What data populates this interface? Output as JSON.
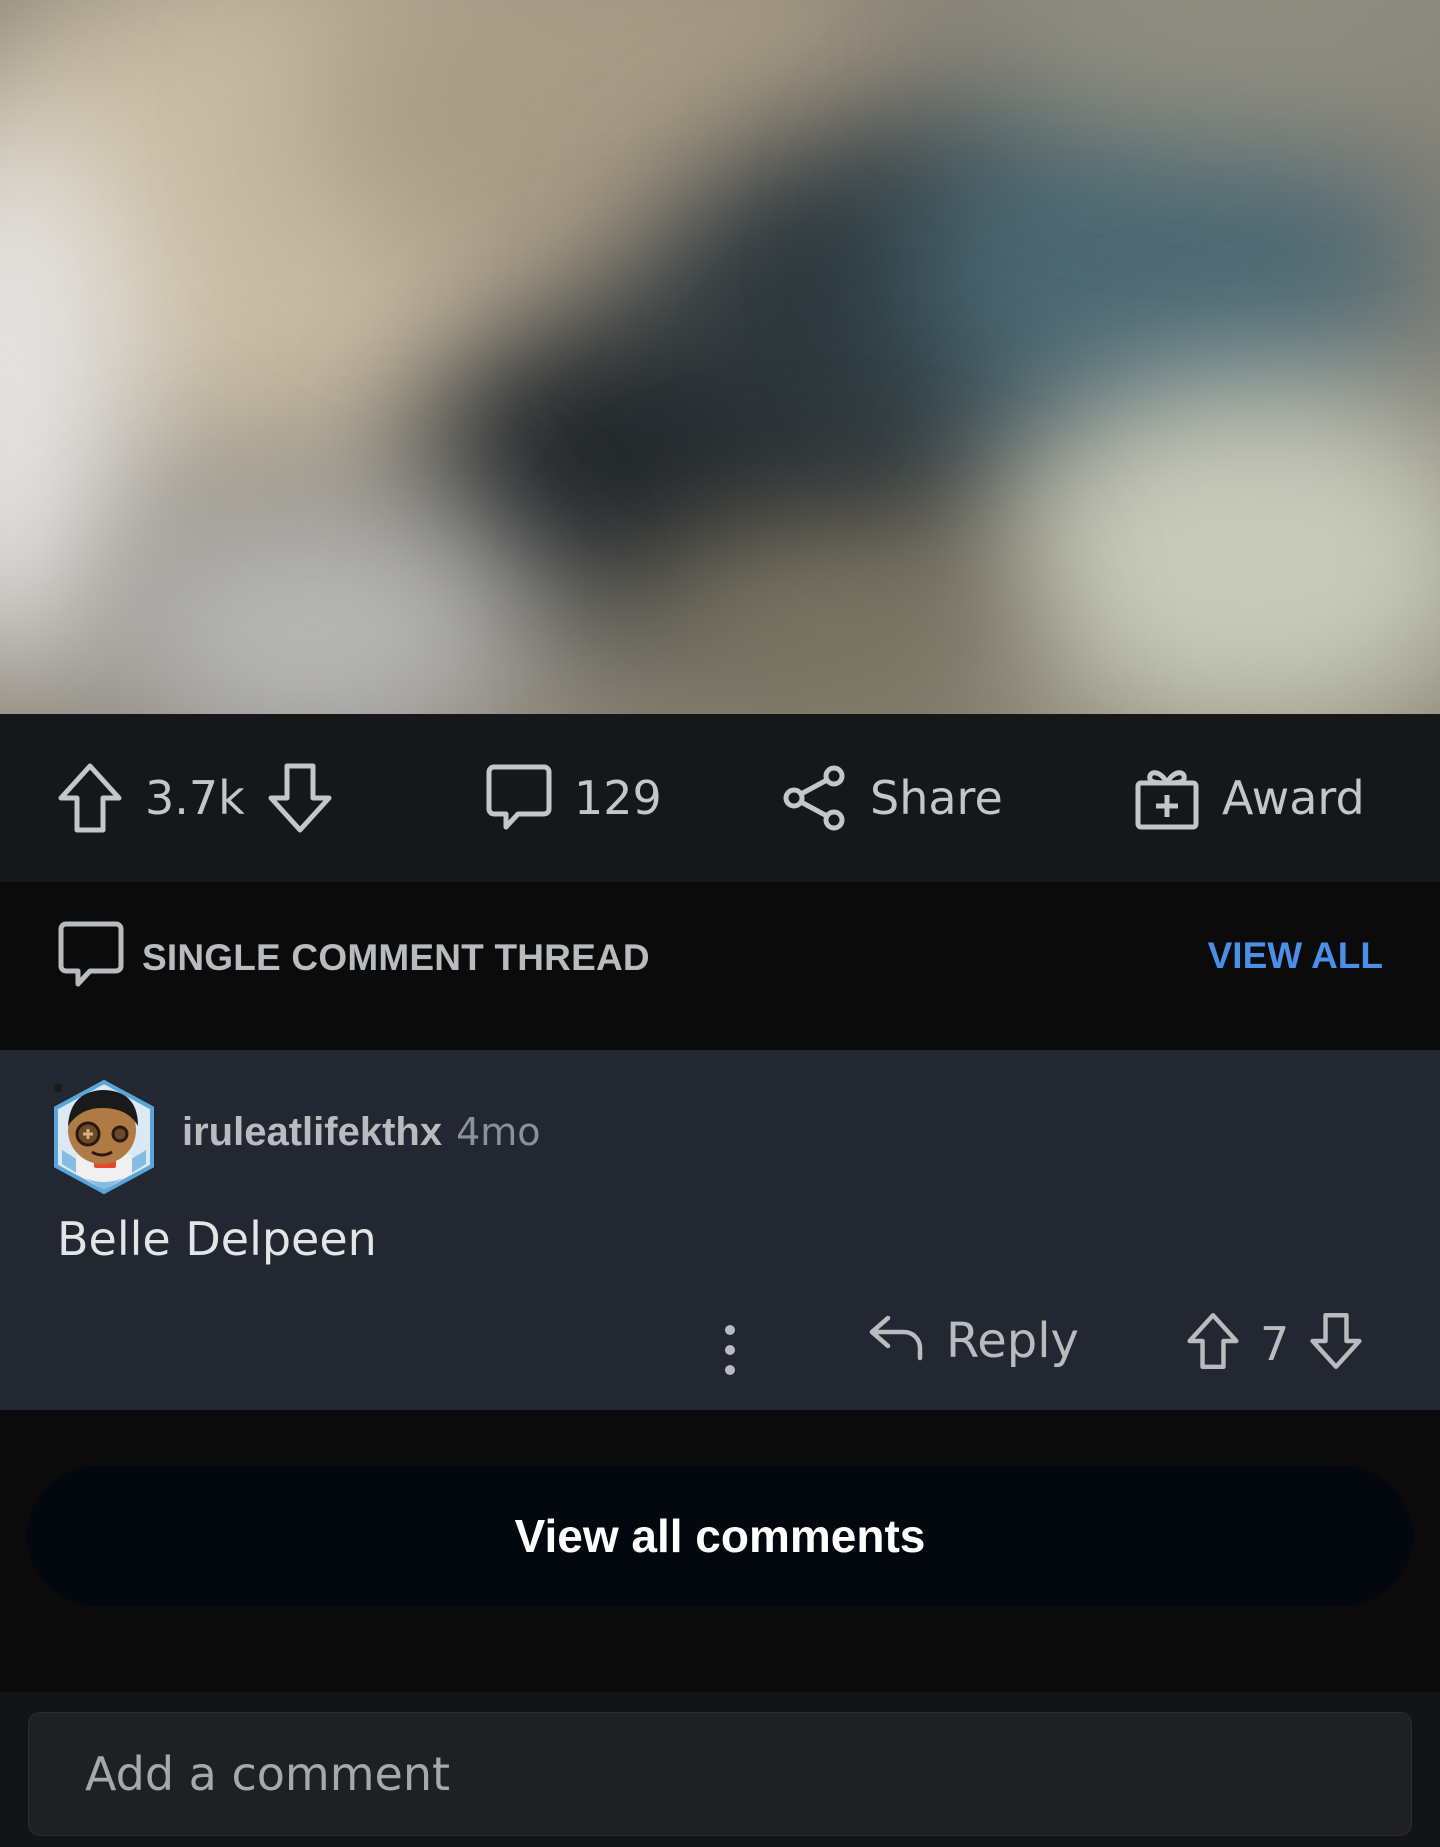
{
  "media": {
    "description_icon": "blurred-image"
  },
  "actions": {
    "upvote_icon": "arrow-up-icon",
    "score": "3.7k",
    "downvote_icon": "arrow-down-icon",
    "comments_icon": "comment-bubble-icon",
    "comment_count": "129",
    "share_icon": "share-icon",
    "share_label": "Share",
    "award_icon": "gift-icon",
    "award_label": "Award"
  },
  "thread": {
    "title": "SINGLE COMMENT THREAD",
    "view_all": "VIEW ALL",
    "accent": "#4c8fe6"
  },
  "comment": {
    "author": "iruleatlifekthx",
    "age": "4mo",
    "body": "Belle Delpeen",
    "reply_label": "Reply",
    "score": "7"
  },
  "view_all_comments": "View all comments",
  "composer": {
    "placeholder": "Add a comment"
  }
}
